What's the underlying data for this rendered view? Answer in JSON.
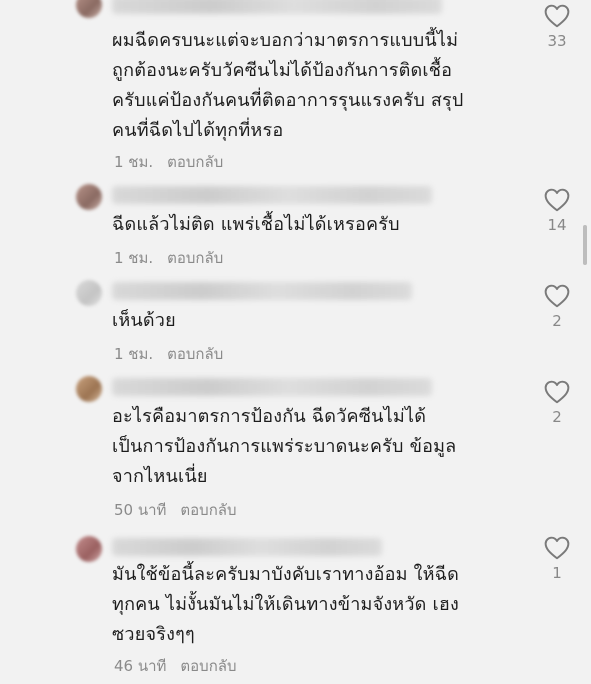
{
  "comments": [
    {
      "text": "ผมฉีดครบนะแต่จะบอกว่ามาตรการแบบนี้ไม่\nถูกต้องนะครับวัคซีนไม่ได้ป้องกันการติดเชื้อ\nครับแค่ป้องกันคนที่ติดอาการรุนแรงครับ สรุป\nคนที่ฉีดไปได้ทุกที่หรอ",
      "time": "1 ชม.",
      "reply": "ตอบกลับ",
      "likes": "33"
    },
    {
      "text": "ฉีดแล้วไม่ติด แพร่เชื้อไม่ได้เหรอครับ",
      "time": "1 ชม.",
      "reply": "ตอบกลับ",
      "likes": "14"
    },
    {
      "text": "เห็นด้วย",
      "time": "1 ชม.",
      "reply": "ตอบกลับ",
      "likes": "2"
    },
    {
      "text": "อะไรคือมาตรการป้องกัน ฉีดวัคซีนไม่ได้\nเป็นการป้องกันการแพร่ระบาดนะครับ ข้อมูล\nจากไหนเนี่ย",
      "time": "50 นาที",
      "reply": "ตอบกลับ",
      "likes": "2"
    },
    {
      "text": "มันใช้ข้อนี้ละครับมาบังคับเราทางอ้อม ให้ฉีด\nทุกคน ไม่งั้นมันไม่ให้เดินทางข้ามจังหวัด เฮง\nซวยจริงๆๆ",
      "time": "46 นาที",
      "reply": "ตอบกลับ",
      "likes": "1"
    }
  ],
  "icons": {
    "like": "heart-outline-icon"
  },
  "colors": {
    "background": "#f2f2f2",
    "text": "#1d1d1d",
    "meta": "#8a8a8a"
  }
}
